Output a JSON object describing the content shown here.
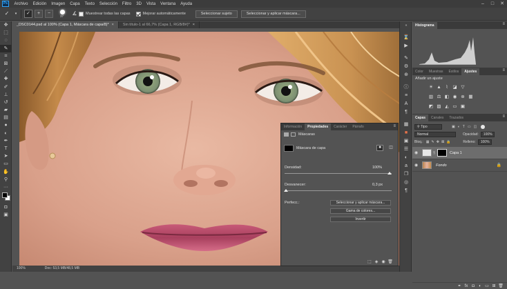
{
  "app": {
    "logo": "Ps"
  },
  "menu": [
    "Archivo",
    "Edición",
    "Imagen",
    "Capa",
    "Texto",
    "Selección",
    "Filtro",
    "3D",
    "Vista",
    "Ventana",
    "Ayuda"
  ],
  "window_controls": [
    "–",
    "□",
    "✕"
  ],
  "options_bar": {
    "brush_size": "37",
    "sample_all_layers": "Muestrear todas las capas",
    "auto_enhance": "Mejorar automáticamente",
    "select_subject": "Seleccionar sujeto",
    "select_and_mask": "Seleccionar y aplicar máscara..."
  },
  "doc_tabs": [
    {
      "label": "_DSC0144.psd al 100% (Capa 1, Máscara de capa/8)",
      "suffix": "*",
      "close": "×"
    },
    {
      "label": "Sin título-1 al 66,7% (Capa 1, RGB/8#)",
      "suffix": "*",
      "close": "×"
    }
  ],
  "status": {
    "zoom": "100%",
    "doc": "Doc: 53,5 MB/48,5 MB"
  },
  "panels": {
    "histogram_tab": "Histograma",
    "adjust_tabs": [
      "Color",
      "Muestras",
      "Estilos",
      "Ajustes"
    ],
    "adjust_title": "Añadir un ajuste",
    "layers_tabs": [
      "Capas",
      "Canales",
      "Trazados"
    ],
    "filter_kind": "Tipo",
    "blend_mode": "Normal",
    "opacity_label": "Opacidad:",
    "opacity_value": "100%",
    "lock_label": "Bloq.:",
    "fill_label": "Relleno:",
    "fill_value": "100%",
    "layers": [
      {
        "name": "Capa 1",
        "has_mask": true,
        "selected": true
      },
      {
        "name": "Fondo",
        "has_mask": false,
        "selected": false,
        "locked": true
      }
    ]
  },
  "properties": {
    "tabs": [
      "Información",
      "Propiedades",
      "Carácter",
      "Párrafo"
    ],
    "section": "Máscaras",
    "mask_label": "Máscara de capa",
    "density_label": "Densidad:",
    "density_value": "100%",
    "feather_label": "Desvanecer:",
    "feather_value": "0,3 px",
    "refine_label": "Perfecc.:",
    "btn_select_mask": "Seleccionar y aplicar máscara...",
    "btn_color_range": "Gama de colores...",
    "btn_invert": "Invertir"
  },
  "colors": {
    "accent": "#31a8ff",
    "ui_dark": "#424242",
    "ui_bg": "#535353"
  }
}
